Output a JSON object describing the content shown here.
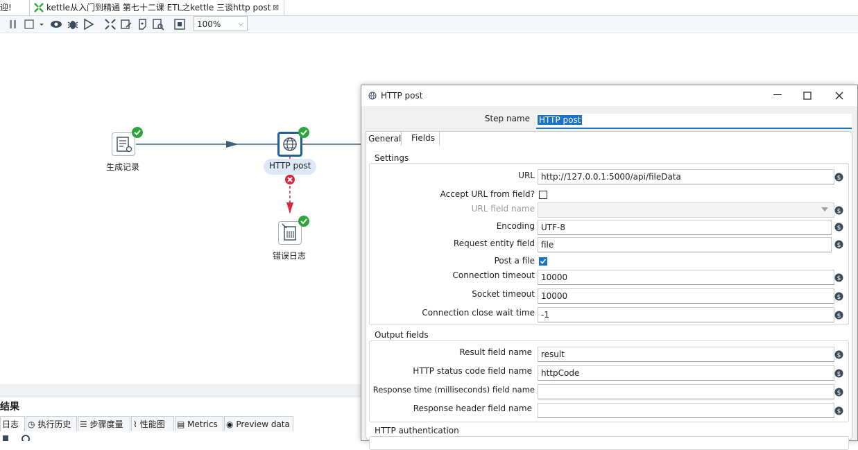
{
  "tabs": {
    "prev_tab_label": "迎!",
    "active_tab_title": "kettle从入门到精通 第七十二课 ETL之kettle 三谈http post",
    "close_glyph": "⊠"
  },
  "toolbar": {
    "zoom_value": "100%",
    "icons": [
      "pause-icon",
      "stop-icon",
      "dropdown-icon",
      "preview-icon",
      "debug-icon",
      "replay-icon",
      "check-icon",
      "analyze-icon",
      "sql-icon",
      "explore-db-icon",
      "layout-icon"
    ]
  },
  "canvas": {
    "steps": [
      {
        "label": "生成记录",
        "icon": "generate-rows-icon",
        "status": "ok"
      },
      {
        "label": "HTTP post",
        "icon": "http-globe-icon",
        "status": "ok"
      },
      {
        "label": "错误日志",
        "icon": "write-log-icon",
        "status": "ok"
      }
    ]
  },
  "bottom": {
    "title": "结果",
    "tabs": [
      "日志",
      "执行历史",
      "步骤度量",
      "性能图",
      "Metrics",
      "Preview data"
    ]
  },
  "dialog": {
    "title": "HTTP post",
    "step_name_label": "Step name",
    "step_name_value": "HTTP post",
    "tabs": [
      "General",
      "Fields"
    ],
    "settings": {
      "group_title": "Settings",
      "url_label": "URL",
      "url_value": "http://127.0.0.1:5000/api/fileData",
      "accept_url_label": "Accept URL from field?",
      "accept_url_checked": false,
      "url_field_name_label": "URL field name",
      "url_field_name_value": "",
      "encoding_label": "Encoding",
      "encoding_value": "UTF-8",
      "request_entity_label": "Request entity field",
      "request_entity_value": "file",
      "post_file_label": "Post a file",
      "post_file_checked": true,
      "connection_timeout_label": "Connection timeout",
      "connection_timeout_value": "10000",
      "socket_timeout_label": "Socket timeout",
      "socket_timeout_value": "10000",
      "close_wait_label": "Connection close wait time",
      "close_wait_value": "-1"
    },
    "output": {
      "group_title": "Output fields",
      "result_label": "Result field name",
      "result_value": "result",
      "status_label": "HTTP status code field name",
      "status_value": "httpCode",
      "response_time_label": "Response time (milliseconds) field name",
      "response_time_value": "",
      "response_header_label": "Response header field name",
      "response_header_value": ""
    },
    "auth": {
      "group_title": "HTTP authentication"
    }
  },
  "colors": {
    "hop_normal": "#3f5f7f",
    "hop_error": "#d9263a",
    "status_ok": "#2aa63a",
    "selection": "#1c5d9a"
  }
}
